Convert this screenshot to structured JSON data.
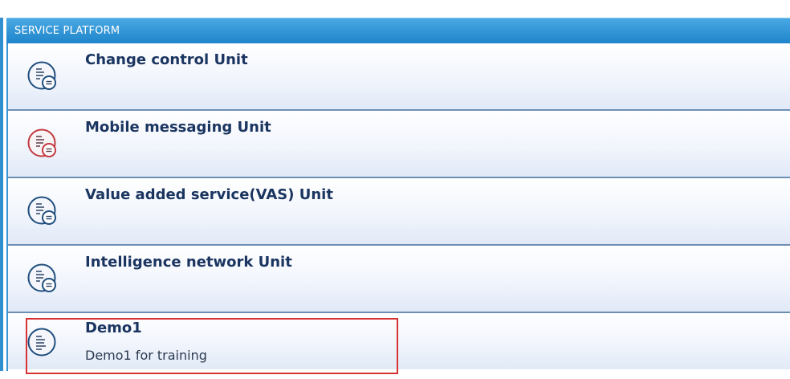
{
  "panel": {
    "title": "SERVICE PLATFORM",
    "accent_color": "#1e84cb",
    "highlight_color": "#d73335"
  },
  "items": [
    {
      "title": "Change control Unit",
      "description": "",
      "icon": "document-list-icon",
      "icon_color": "#1f4e7e"
    },
    {
      "title": "Mobile messaging Unit",
      "description": "",
      "icon": "document-list-icon",
      "icon_color": "#c23a40"
    },
    {
      "title": "Value added service(VAS) Unit",
      "description": "",
      "icon": "document-list-icon",
      "icon_color": "#1f4e7e"
    },
    {
      "title": "Intelligence network Unit",
      "description": "",
      "icon": "document-list-icon",
      "icon_color": "#1f4e7e"
    },
    {
      "title": "Demo1",
      "description": "Demo1 for training",
      "icon": "document-icon",
      "icon_color": "#1f4e7e",
      "highlighted": true
    }
  ]
}
